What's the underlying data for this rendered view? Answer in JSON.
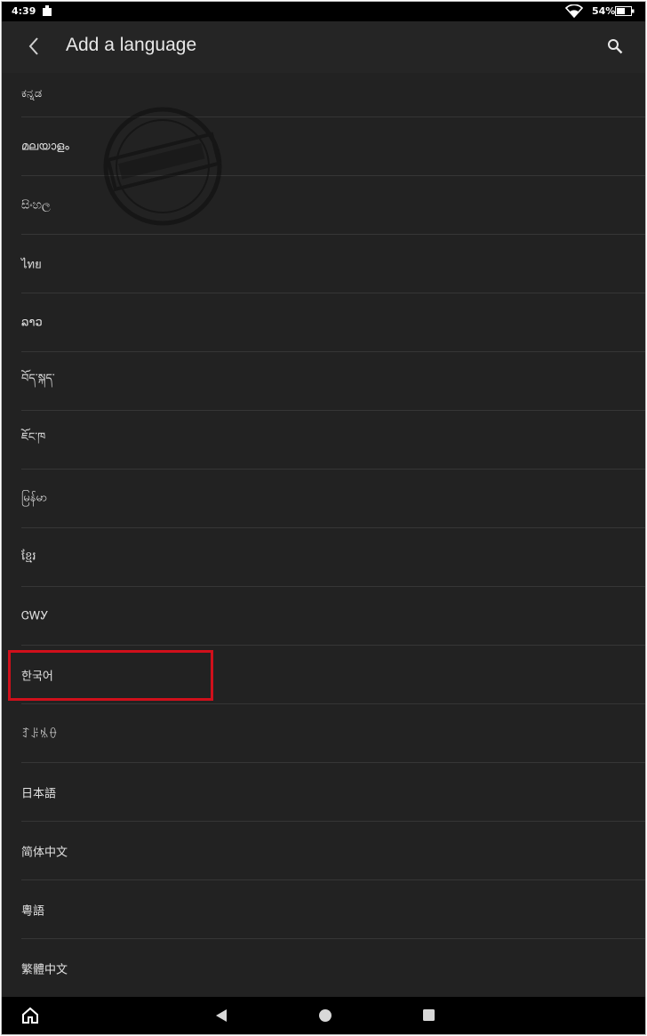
{
  "status": {
    "time": "4:39",
    "battery": "54%"
  },
  "header": {
    "title": "Add a language"
  },
  "languages": [
    "ಕನ್ನಡ",
    "മലയാളം",
    "සිංහල",
    "ไทย",
    "ລາວ",
    "བོད་སྐད་",
    "ཇོང་ཁ",
    "မြန်မာ",
    "ខ្មែរ",
    "ᏣᎳᎩ",
    "한국어",
    "ꆈꌠꁱꂷ",
    "日本語",
    "简体中文",
    "粵語",
    "繁體中文"
  ],
  "highlight_color": "#d0101b",
  "icons": {
    "back": "chevron-left-icon",
    "search": "search-icon",
    "nav_back": "triangle-back-icon",
    "nav_home": "circle-home-icon",
    "nav_recent": "square-recent-icon"
  }
}
